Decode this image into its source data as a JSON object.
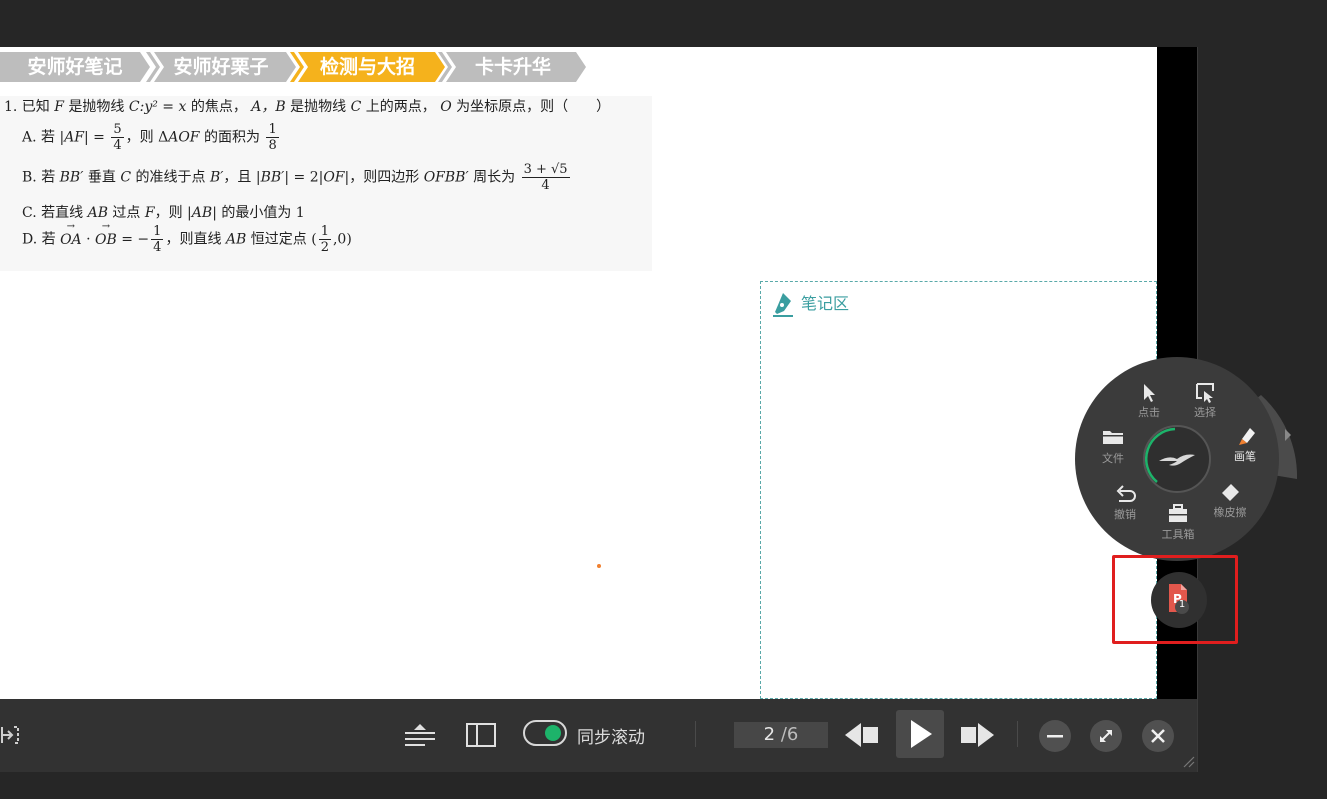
{
  "tabs": [
    {
      "label": "安师好笔记",
      "state": "inactive"
    },
    {
      "label": "安师好栗子",
      "state": "inactive"
    },
    {
      "label": "检测与大招",
      "state": "active"
    },
    {
      "label": "卡卡升华",
      "state": "inactive"
    }
  ],
  "colors": {
    "tab_inactive": "#bdbdbd",
    "tab_active": "#f5b21c",
    "notes_accent": "#3b9ea0",
    "toggle_on": "#1db36a",
    "highlight_box": "#e01e1e"
  },
  "question": {
    "stem_a": "1. 已知",
    "stem_F": "F",
    "stem_b": " 是抛物线 ",
    "stem_curve": "C:y² = x",
    "stem_c": " 的焦点，",
    "stem_AB": "A，B",
    "stem_d": " 是抛物线 ",
    "stem_C": "C",
    "stem_e": " 上的两点，",
    "stem_O": "O",
    "stem_f": " 为坐标原点，则（　　）",
    "optA_pre": "A. 若 |",
    "optA_AF": "AF",
    "optA_eq": "| = ",
    "optA_num": "5",
    "optA_den": "4",
    "optA_mid": "，则 Δ",
    "optA_AOF": "AOF",
    "optA_post": " 的面积为 ",
    "optA_num2": "1",
    "optA_den2": "8",
    "optB_pre": "B. 若 ",
    "optB_BB": "BB′",
    "optB_mid1": " 垂直 ",
    "optB_C": "C",
    "optB_mid2": " 的准线于点 ",
    "optB_Bp": "B′",
    "optB_mid3": "，且 |",
    "optB_BB2": "BB′",
    "optB_mid4": "| = 2|",
    "optB_OF": "OF",
    "optB_mid5": "|，则四边形 ",
    "optB_OFBB": "OFBB′",
    "optB_mid6": " 周长为 ",
    "optB_num": "3 + √5",
    "optB_den": "4",
    "optC_pre": "C. 若直线 ",
    "optC_AB": "AB",
    "optC_mid1": " 过点 ",
    "optC_F": "F",
    "optC_mid2": "，则 |",
    "optC_AB2": "AB",
    "optC_post": "| 的最小值为 1",
    "optD_pre": "D. 若 ",
    "optD_OA": "OA",
    "optD_dot": " · ",
    "optD_OB": "OB",
    "optD_eq": " = −",
    "optD_num": "1",
    "optD_den": "4",
    "optD_mid": "，则直线 ",
    "optD_AB": "AB",
    "optD_mid2": " 恒过定点 (",
    "optD_num2": "1",
    "optD_den2": "2",
    "optD_post": ",0)"
  },
  "notes": {
    "title": "笔记区"
  },
  "dial": {
    "click": "点击",
    "select": "选择",
    "file": "文件",
    "pen": "画笔",
    "undo": "撤销",
    "eraser": "橡皮擦",
    "toolbox": "工具箱"
  },
  "ppt_badge": "1",
  "toolbar": {
    "sync_label": "同步滚动",
    "page_current": "2",
    "page_total": "/6"
  }
}
